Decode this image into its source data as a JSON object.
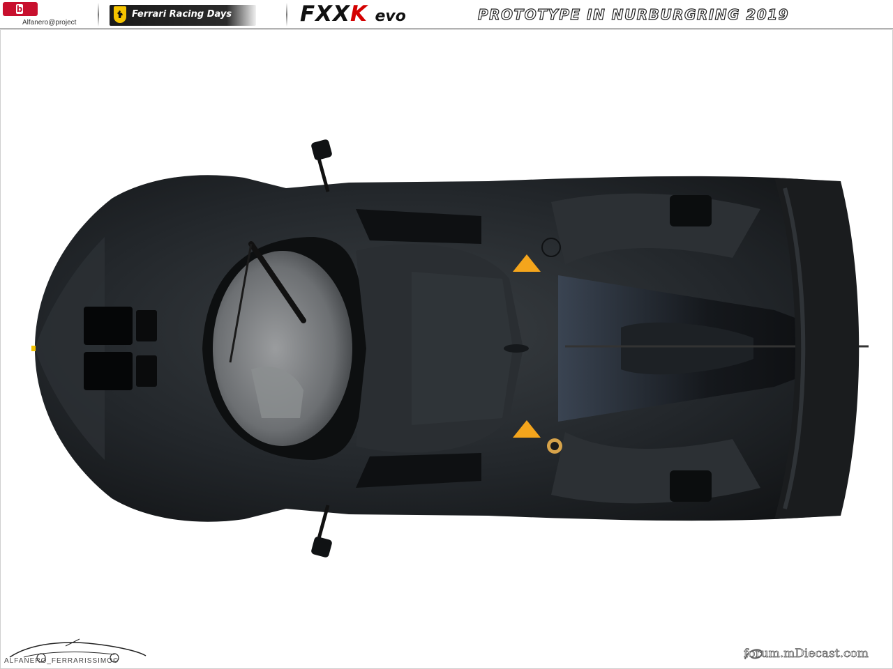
{
  "header": {
    "burago_logo": "burago",
    "burago_credit": "Alfanero@project",
    "ferrari_label": "Ferrari Racing Days",
    "title_fxx": "FXX",
    "title_k": "K",
    "title_evo": "evo",
    "title_sub": "PROTOTYPE IN NURBURGRING 2019"
  },
  "footer": {
    "signature_text": "ALFANERO_FERRARISSIMO©",
    "forum_text": "forum.mDiecast.com"
  },
  "colors": {
    "car_body": "#1f2224",
    "accent_red": "#d40000",
    "warning_triangle": "#f4a51c",
    "ferrari_yellow": "#f5c400"
  },
  "icons": {
    "burago": "burago-logo-icon",
    "ferrari": "prancing-horse-icon",
    "signature": "car-sketch-signature-icon",
    "forum": "swirl-logo-icon"
  }
}
